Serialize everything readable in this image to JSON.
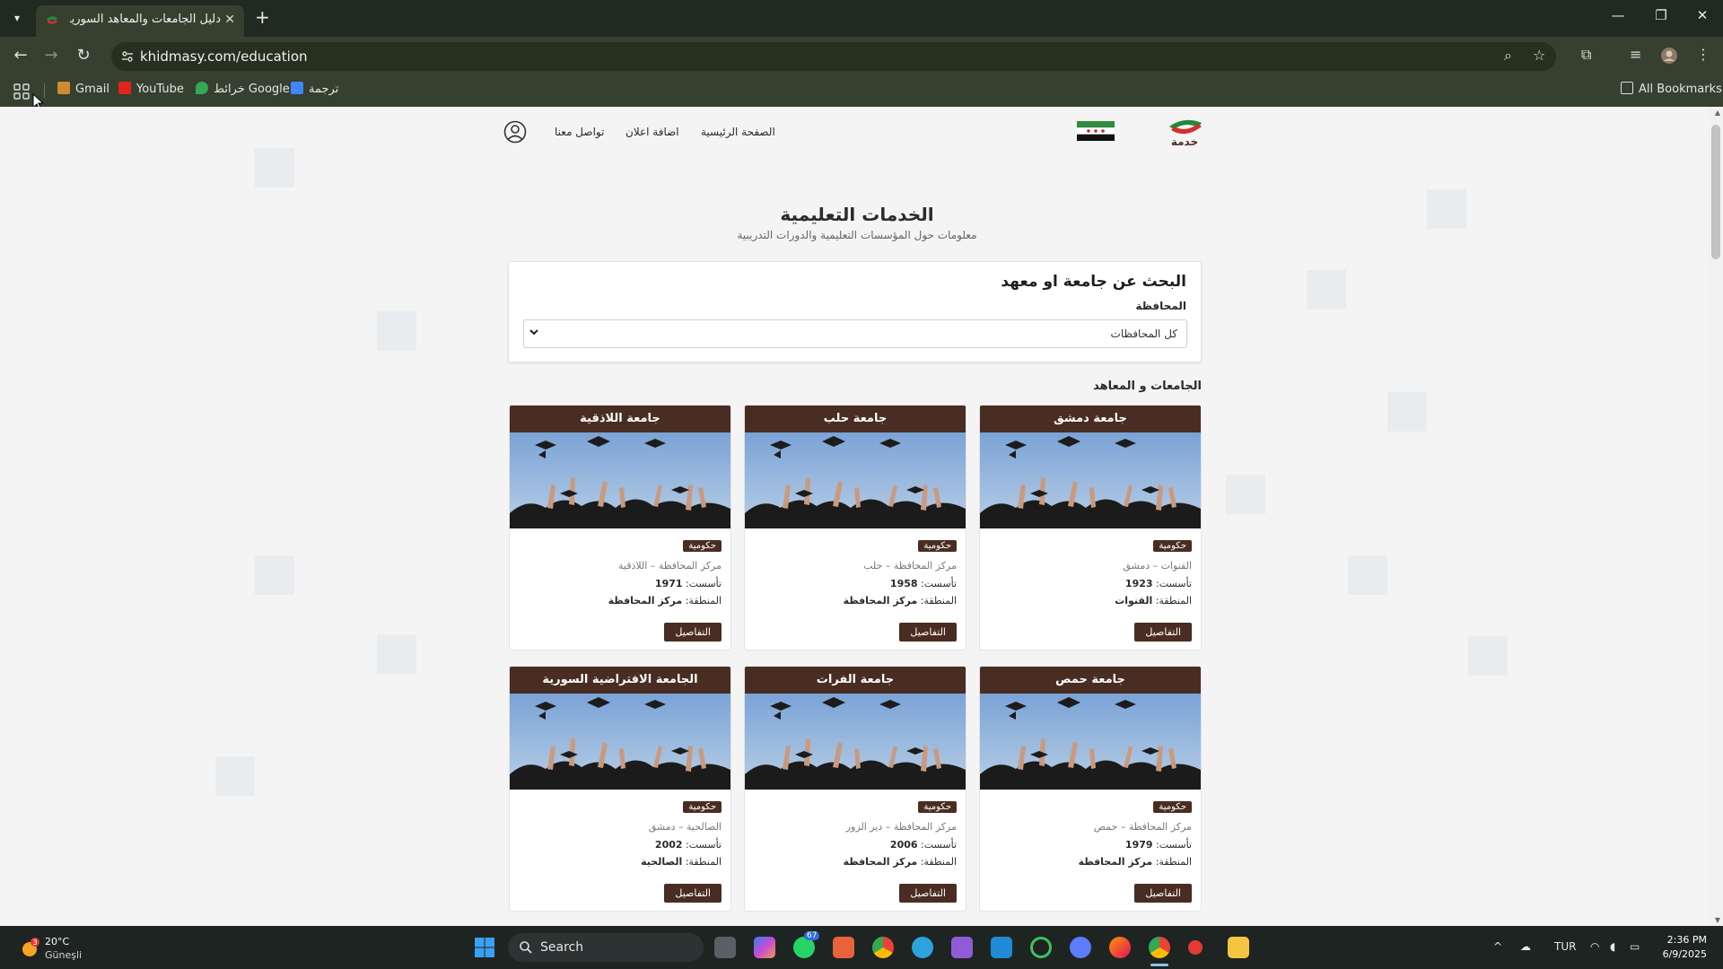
{
  "browser": {
    "tab_title": "دليل الجامعات والمعاهد السورية",
    "url": "khidmasy.com/education",
    "bookmarks": [
      {
        "label": "Gmail",
        "icon": "gmail-icon",
        "color": "#d08a2e"
      },
      {
        "label": "YouTube",
        "icon": "youtube-icon",
        "color": "#e1251b"
      },
      {
        "label": "خرائط Google",
        "icon": "maps-icon",
        "color": "#34a853"
      },
      {
        "label": "ترجمة",
        "icon": "translate-icon",
        "color": "#4285f4"
      }
    ],
    "all_bookmarks": "All Bookmarks"
  },
  "site": {
    "nav": {
      "home": "الصفحة الرئيسية",
      "add_ad": "اضافة اعلان",
      "contact": "تواصل معنا"
    },
    "logo_text": "خدمة",
    "title": "الخدمات التعليمية",
    "subtitle": "معلومات حول المؤسسات التعليمية والدورات التدريبية",
    "search": {
      "title": "البحث عن جامعة او معهد",
      "label": "المحافظة",
      "selected": "كل المحافظات"
    },
    "section_title": "الجامعات و المعاهد",
    "labels": {
      "founded": "تأسست:",
      "region": "المنطقة:",
      "details": "التفاصيل"
    },
    "universities": [
      {
        "name": "جامعة دمشق",
        "badge": "حكومية",
        "location": "القنوات – دمشق",
        "founded": "1923",
        "region": "القنوات"
      },
      {
        "name": "جامعة حلب",
        "badge": "حكومية",
        "location": "مركز المحافظة – حلب",
        "founded": "1958",
        "region": "مركز المحافظة"
      },
      {
        "name": "جامعة اللاذقية",
        "badge": "حكومية",
        "location": "مركز المحافظة – اللاذقية",
        "founded": "1971",
        "region": "مركز المحافظة"
      },
      {
        "name": "جامعة حمص",
        "badge": "حكومية",
        "location": "مركز المحافظة – حمص",
        "founded": "1979",
        "region": "مركز المحافظة"
      },
      {
        "name": "جامعة الفرات",
        "badge": "حكومية",
        "location": "مركز المحافظة – دير الزور",
        "founded": "2006",
        "region": "مركز المحافظة"
      },
      {
        "name": "الجامعة الافتراضية السورية",
        "badge": "حكومية",
        "location": "الصالحية – دمشق",
        "founded": "2002",
        "region": "الصالحية"
      }
    ]
  },
  "taskbar": {
    "weather_temp": "20°C",
    "weather_desc": "Güneşli",
    "weather_badge": "3",
    "search_placeholder": "Search",
    "whatsapp_badge": "67",
    "language": "TUR",
    "time": "2:36 PM",
    "date": "6/9/2025"
  },
  "colors": {
    "brand_brown": "#4a2d22",
    "chrome_dark": "#1f2a20",
    "chrome_toolbar": "#35402f"
  }
}
